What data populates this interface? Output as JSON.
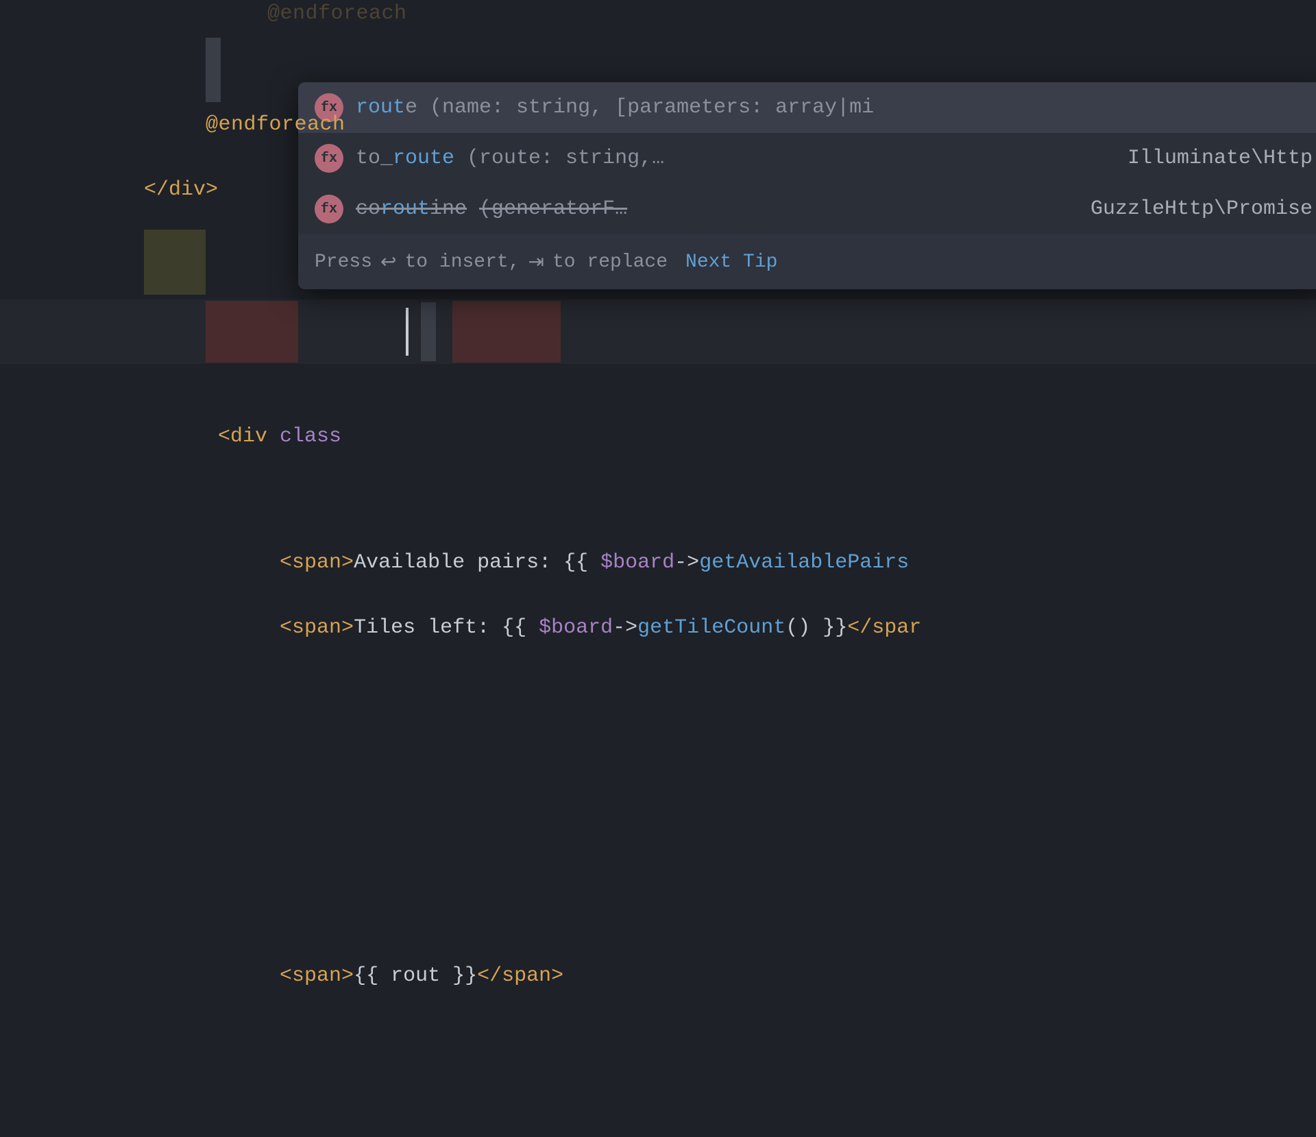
{
  "code": {
    "line1": "@endforeach",
    "line2": "@endforeach",
    "line3": "</div>",
    "line5_tag_open": "<div",
    "line5_attr": " class",
    "line6_tag_open": "<span>",
    "line6_brace_open": "{{ ",
    "line6_typed": "rout",
    "line6_brace_close": " }}",
    "line6_tag_close": "</span>",
    "line8_tag_open": "<span>",
    "line8_text": "Available pairs: ",
    "line8_brace_open": "{{ ",
    "line8_var": "$board",
    "line8_arrow": "->",
    "line8_fn": "getAvailablePairs",
    "line9_tag_open": "<span>",
    "line9_text": "Tiles left: ",
    "line9_brace_open": "{{ ",
    "line9_var": "$board",
    "line9_arrow": "->",
    "line9_fn": "getTileCount",
    "line9_paren": "() ",
    "line9_brace_close": "}}",
    "line9_tag_close": "</spar"
  },
  "popup": {
    "items": [
      {
        "name_pre": "rout",
        "name_match_tail": "e",
        "sig": "(name: string, [parameters: array|mi",
        "ns": "",
        "strike": false
      },
      {
        "name_pre": "to_",
        "name_match": "route",
        "sig": "(route: string,…",
        "ns": "Illuminate\\Http",
        "strike": false
      },
      {
        "name_pre": "co",
        "name_match": "rout",
        "name_post": "ine",
        "sig": "(generatorF…",
        "ns": "GuzzleHttp\\Promise",
        "strike": true
      }
    ],
    "footer_pre": "Press ",
    "footer_key1": "↩",
    "footer_mid1": " to insert, ",
    "footer_key2": "⇥",
    "footer_mid2": " to replace",
    "next_tip": "Next Tip"
  },
  "icons": {
    "fx": "fx"
  }
}
